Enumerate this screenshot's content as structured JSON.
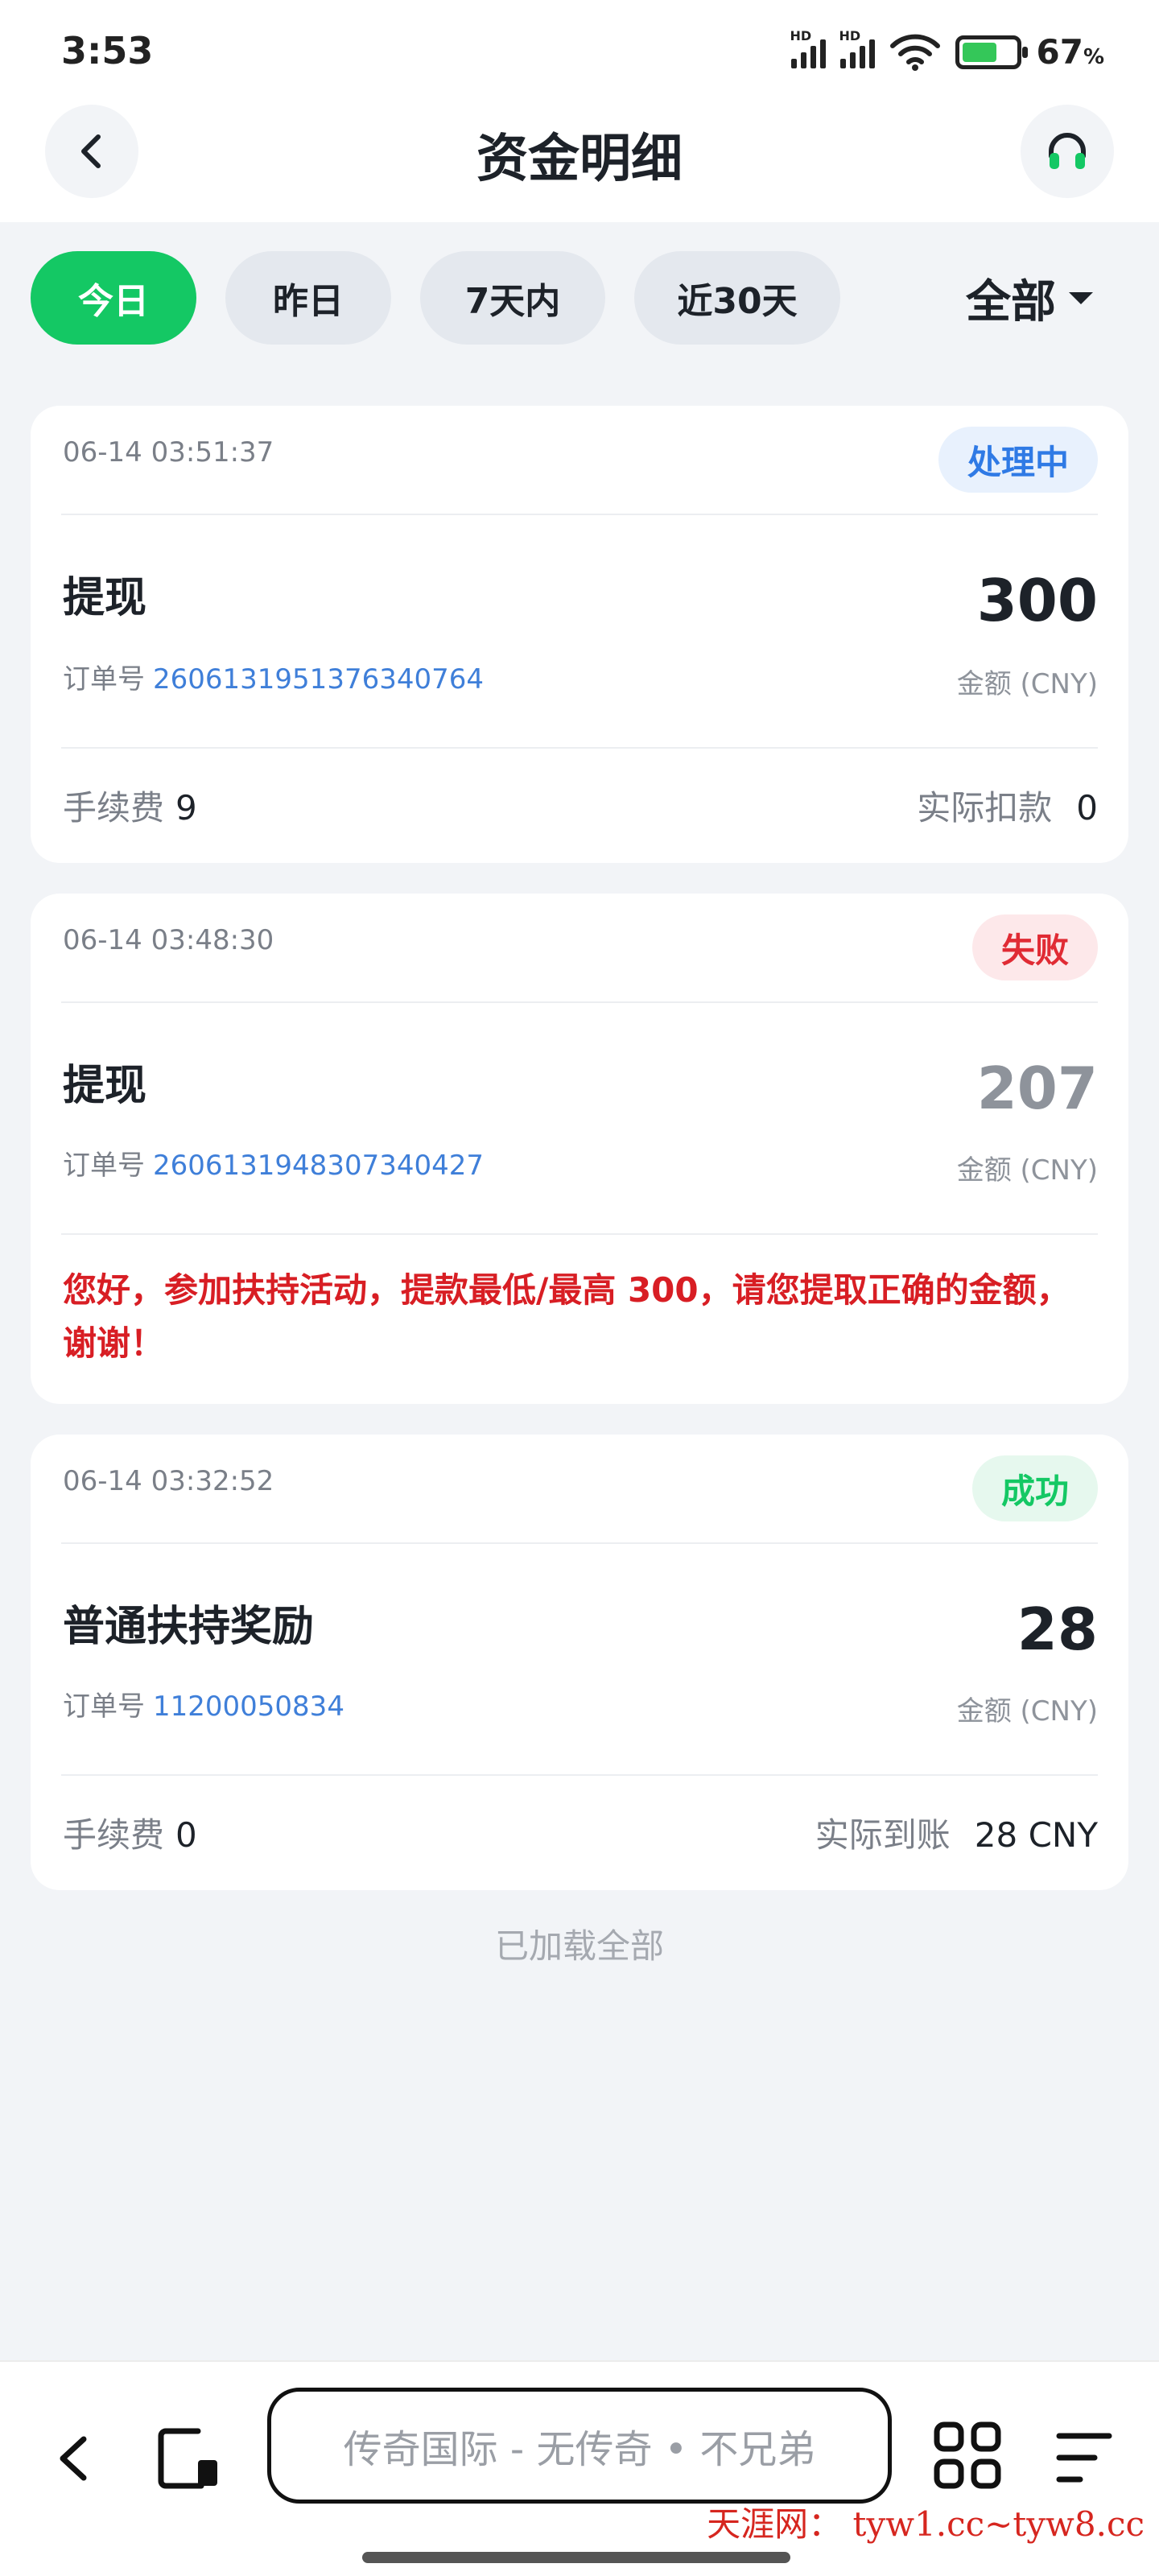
{
  "status_bar": {
    "time": "3:53",
    "battery": "67",
    "battery_unit": "%",
    "network_label": "HD"
  },
  "header": {
    "title": "资金明细"
  },
  "filters": {
    "chips": [
      {
        "label": "今日",
        "active": true
      },
      {
        "label": "昨日",
        "active": false
      },
      {
        "label": "7天内",
        "active": false
      },
      {
        "label": "近30天",
        "active": false
      }
    ],
    "dropdown_value": "全部"
  },
  "transactions": [
    {
      "time": "06-14 03:51:37",
      "status": "处理中",
      "type": "提现",
      "order_label": "订单号",
      "order_no": "2606131951376340764",
      "amount": "300",
      "unit": "金额 (CNY)",
      "fee_label": "手续费",
      "fee": "9",
      "actual_label": "实际扣款",
      "actual": "0"
    },
    {
      "time": "06-14 03:48:30",
      "status": "失败",
      "type": "提现",
      "order_label": "订单号",
      "order_no": "2606131948307340427",
      "amount": "207",
      "unit": "金额 (CNY)",
      "message": "您好，参加扶持活动，提款最低/最高 300，请您提取正确的金额，谢谢！"
    },
    {
      "time": "06-14 03:32:52",
      "status": "成功",
      "type": "普通扶持奖励",
      "order_label": "订单号",
      "order_no": "11200050834",
      "amount": "28",
      "unit": "金额 (CNY)",
      "fee_label": "手续费",
      "fee": "0",
      "actual_label": "实际到账",
      "actual": "28 CNY"
    }
  ],
  "list_footer": "已加载全部",
  "browser": {
    "url_text": "传奇国际 - 无传奇 • 不兄弟",
    "watermark": "天涯网： tyw1.cc~tyw8.cc"
  },
  "colors": {
    "accent_green": "#14c864",
    "processing_blue": "#2f7ae5",
    "failed_red": "#e02b34",
    "order_link_blue": "#3f7fd9"
  }
}
